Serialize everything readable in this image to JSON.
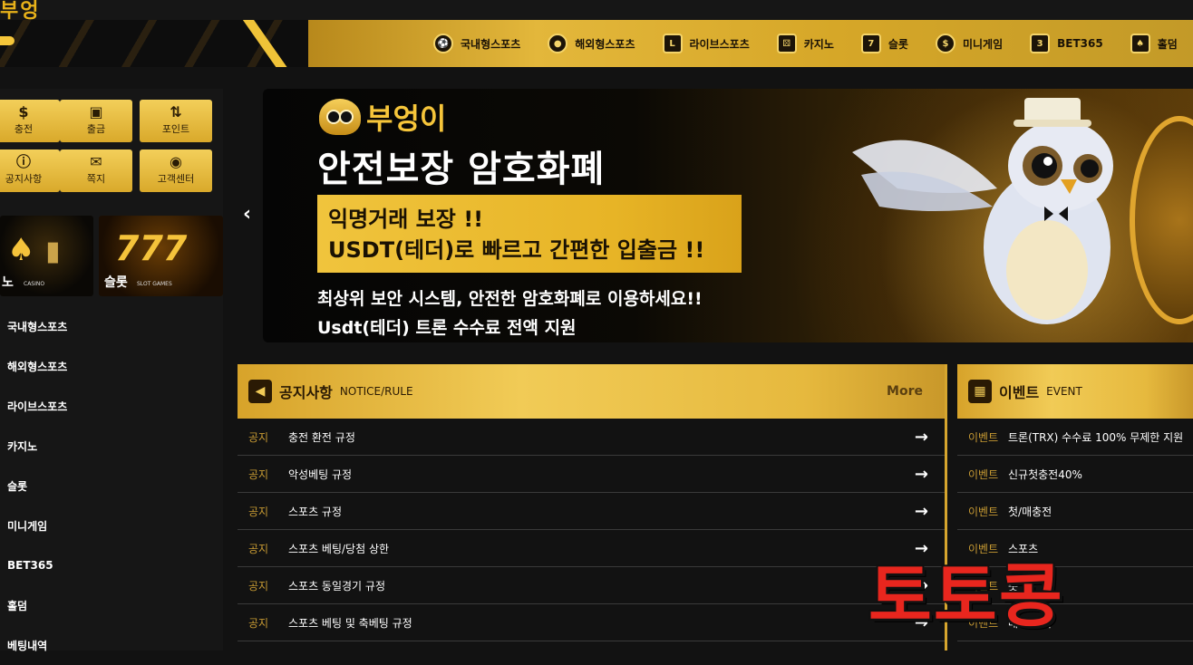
{
  "brand": {
    "top_fragment": "부엉",
    "name": "부엉이"
  },
  "colors": {
    "gold": "#e6b93e",
    "dark": "#121212",
    "accent_text": "#c79a33",
    "watermark": "#e8261e"
  },
  "nav": {
    "items": [
      {
        "label": "국내형스포츠",
        "icon": "soccer-ball-icon"
      },
      {
        "label": "해외형스포츠",
        "icon": "basketball-icon"
      },
      {
        "label": "라이브스포츠",
        "icon": "live-icon"
      },
      {
        "label": "카지노",
        "icon": "dice-icon"
      },
      {
        "label": "슬롯",
        "icon": "slot-machine-icon"
      },
      {
        "label": "미니게임",
        "icon": "coin-icon"
      },
      {
        "label": "BET365",
        "icon": "bet365-icon"
      },
      {
        "label": "홀덤",
        "icon": "cards-icon"
      }
    ]
  },
  "quick_buttons": [
    {
      "label": "충전",
      "icon": "money-bag-icon"
    },
    {
      "label": "출금",
      "icon": "wallet-icon"
    },
    {
      "label": "포인트",
      "icon": "exchange-icon"
    },
    {
      "label": "공지사항",
      "icon": "info-icon"
    },
    {
      "label": "쪽지",
      "icon": "envelope-icon"
    },
    {
      "label": "고객센터",
      "icon": "chat-icon"
    }
  ],
  "promos": {
    "casino": {
      "label": "노",
      "sub": "CASINO"
    },
    "slot": {
      "big": "777",
      "label": "슬롯",
      "sub": "SLOT GAMES"
    }
  },
  "sidebar_menu": [
    "국내형스포츠",
    "해외형스포츠",
    "라이브스포츠",
    "카지노",
    "슬롯",
    "미니게임",
    "BET365",
    "홀덤",
    "베팅내역"
  ],
  "banner": {
    "brand": "부엉이",
    "headline": "안전보장 암호화폐",
    "box_line1": "익명거래 보장 !!",
    "box_line2": "USDT(테더)로 빠르고 간편한 입출금 !!",
    "line1": "최상위 보안 시스템, 안전한 암호화폐로 이용하세요!!",
    "line2": "Usdt(테더) 트론 수수료 전액 지원",
    "prev": "‹"
  },
  "notice": {
    "title": "공지사항",
    "subtitle": "NOTICE/RULE",
    "more": "More",
    "rows": [
      {
        "tag": "공지",
        "text": "충전 환전 규정"
      },
      {
        "tag": "공지",
        "text": "악성베팅 규정"
      },
      {
        "tag": "공지",
        "text": "스포츠 규정"
      },
      {
        "tag": "공지",
        "text": "스포츠 베팅/당첨 상한"
      },
      {
        "tag": "공지",
        "text": "스포츠 동일경기 규정"
      },
      {
        "tag": "공지",
        "text": "스포츠 베팅 및 축베팅 규정"
      }
    ]
  },
  "event": {
    "title": "이벤트",
    "subtitle": "EVENT",
    "rows": [
      {
        "tag": "이벤트",
        "text": "트론(TRX) 수수료 100% 무제한 지원"
      },
      {
        "tag": "이벤트",
        "text": "신규첫충전40%"
      },
      {
        "tag": "이벤트",
        "text": "첫/매충전"
      },
      {
        "tag": "이벤트",
        "text": "스포츠"
      },
      {
        "tag": "이벤트",
        "text": "룻"
      },
      {
        "tag": "이벤트",
        "text": "매일 출석"
      }
    ]
  },
  "watermark": "토토콩"
}
